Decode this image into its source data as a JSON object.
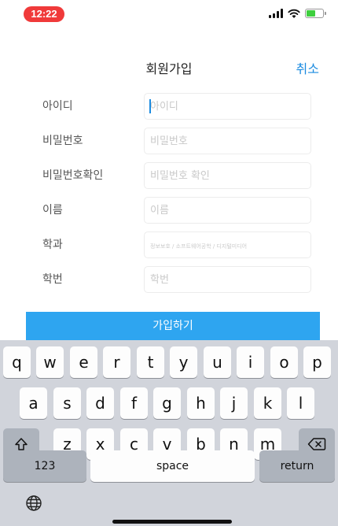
{
  "status_bar": {
    "time": "12:22",
    "icons": [
      "signal-icon",
      "wifi-icon",
      "battery-icon"
    ]
  },
  "nav": {
    "title": "회원가입",
    "cancel": "취소"
  },
  "form": {
    "fields": [
      {
        "label": "아이디",
        "value": "",
        "placeholder": "아이디"
      },
      {
        "label": "비밀번호",
        "value": "",
        "placeholder": "비밀번호"
      },
      {
        "label": "비밀번호확인",
        "value": "",
        "placeholder": "비밀번호 확인"
      },
      {
        "label": "이름",
        "value": "",
        "placeholder": "이름"
      },
      {
        "label": "학과",
        "value": "",
        "placeholder": "정보보호 / 소프트웨어공학 / 디지털미디어"
      },
      {
        "label": "학번",
        "value": "",
        "placeholder": "학번"
      }
    ],
    "submit": "가입하기"
  },
  "keyboard": {
    "row1": [
      "q",
      "w",
      "e",
      "r",
      "t",
      "y",
      "u",
      "i",
      "o",
      "p"
    ],
    "row2": [
      "a",
      "s",
      "d",
      "f",
      "g",
      "h",
      "j",
      "k",
      "l"
    ],
    "row3": [
      "z",
      "x",
      "c",
      "v",
      "b",
      "n",
      "m"
    ],
    "numbers": "123",
    "space": "space",
    "return": "return",
    "icons": {
      "shift": "shift-icon",
      "backspace": "backspace-icon",
      "globe": "globe-icon"
    }
  },
  "colors": {
    "accent": "#2ea5f0",
    "link": "#1b8be0",
    "time_pill": "#f03a3a",
    "keyboard_bg": "#d1d4db"
  }
}
